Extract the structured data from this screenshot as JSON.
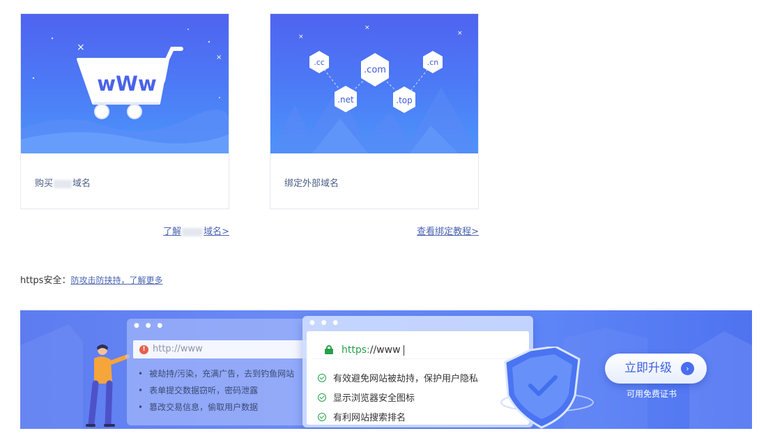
{
  "cards": [
    {
      "caption_prefix": "购买",
      "caption_suffix": "域名",
      "icon_text": "wWw",
      "more_prefix": "了解",
      "more_suffix": "域名>"
    },
    {
      "caption": "绑定外部域名",
      "tlds": [
        ".cc",
        ".com",
        ".cn",
        ".net",
        ".top"
      ],
      "more_text": "查看绑定教程>"
    }
  ],
  "https": {
    "label": "https安全：",
    "link": "防攻击防挟持，了解更多"
  },
  "banner": {
    "old_url": "http://www",
    "old_items": [
      "被劫持/污染，充满广告，去到钓鱼网站",
      "表单提交数据窃听，密码泄露",
      "篡改交易信息，偷取用户数据"
    ],
    "new_scheme": "https:",
    "new_rest": "//www",
    "new_items": [
      "有效避免网站被劫持，保护用户隐私",
      "显示浏览器安全图标",
      "有利网站搜索排名"
    ],
    "upgrade_label": "立即升级",
    "free_cert": "可用免费证书",
    "accent": "#3a5fe0",
    "secure_color": "#27a04a",
    "warn_color": "#e8604c"
  }
}
